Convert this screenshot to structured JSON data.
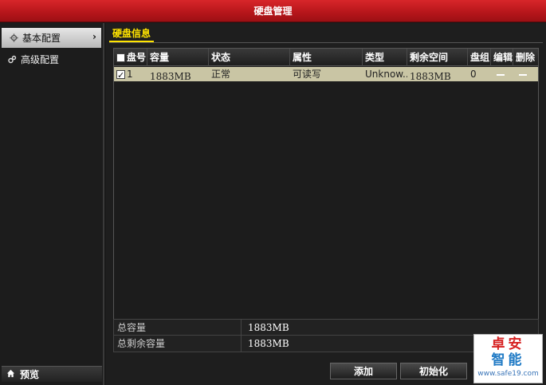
{
  "window": {
    "title": "硬盘管理"
  },
  "sidebar": {
    "items": [
      {
        "label": "基本配置",
        "icon": "gear-icon",
        "active": true
      },
      {
        "label": "高级配置",
        "icon": "gears-icon",
        "active": false
      }
    ],
    "preview_label": "预览"
  },
  "section": {
    "tab_label": "硬盘信息"
  },
  "table": {
    "headers": [
      "盘号",
      "容量",
      "状态",
      "属性",
      "类型",
      "剩余空间",
      "盘组",
      "编辑",
      "删除"
    ],
    "rows": [
      {
        "checked": true,
        "disk_no": "1",
        "capacity": "1883MB",
        "status": "正常",
        "property": "可读写",
        "type": "Unknow...",
        "free_space": "1883MB",
        "group": "0"
      }
    ]
  },
  "summary": {
    "total_capacity_label": "总容量",
    "total_capacity_value": "1883MB",
    "total_free_label": "总剩余容量",
    "total_free_value": "1883MB"
  },
  "buttons": {
    "add_label": "添加",
    "init_label": "初始化"
  },
  "watermark": {
    "line1": "卓安",
    "line2": "智能",
    "url": "www.safe19.com"
  },
  "colors": {
    "titlebar": "#c41a1f",
    "tab_accent": "#ffe400",
    "row_selected": "#c9c5a4"
  }
}
